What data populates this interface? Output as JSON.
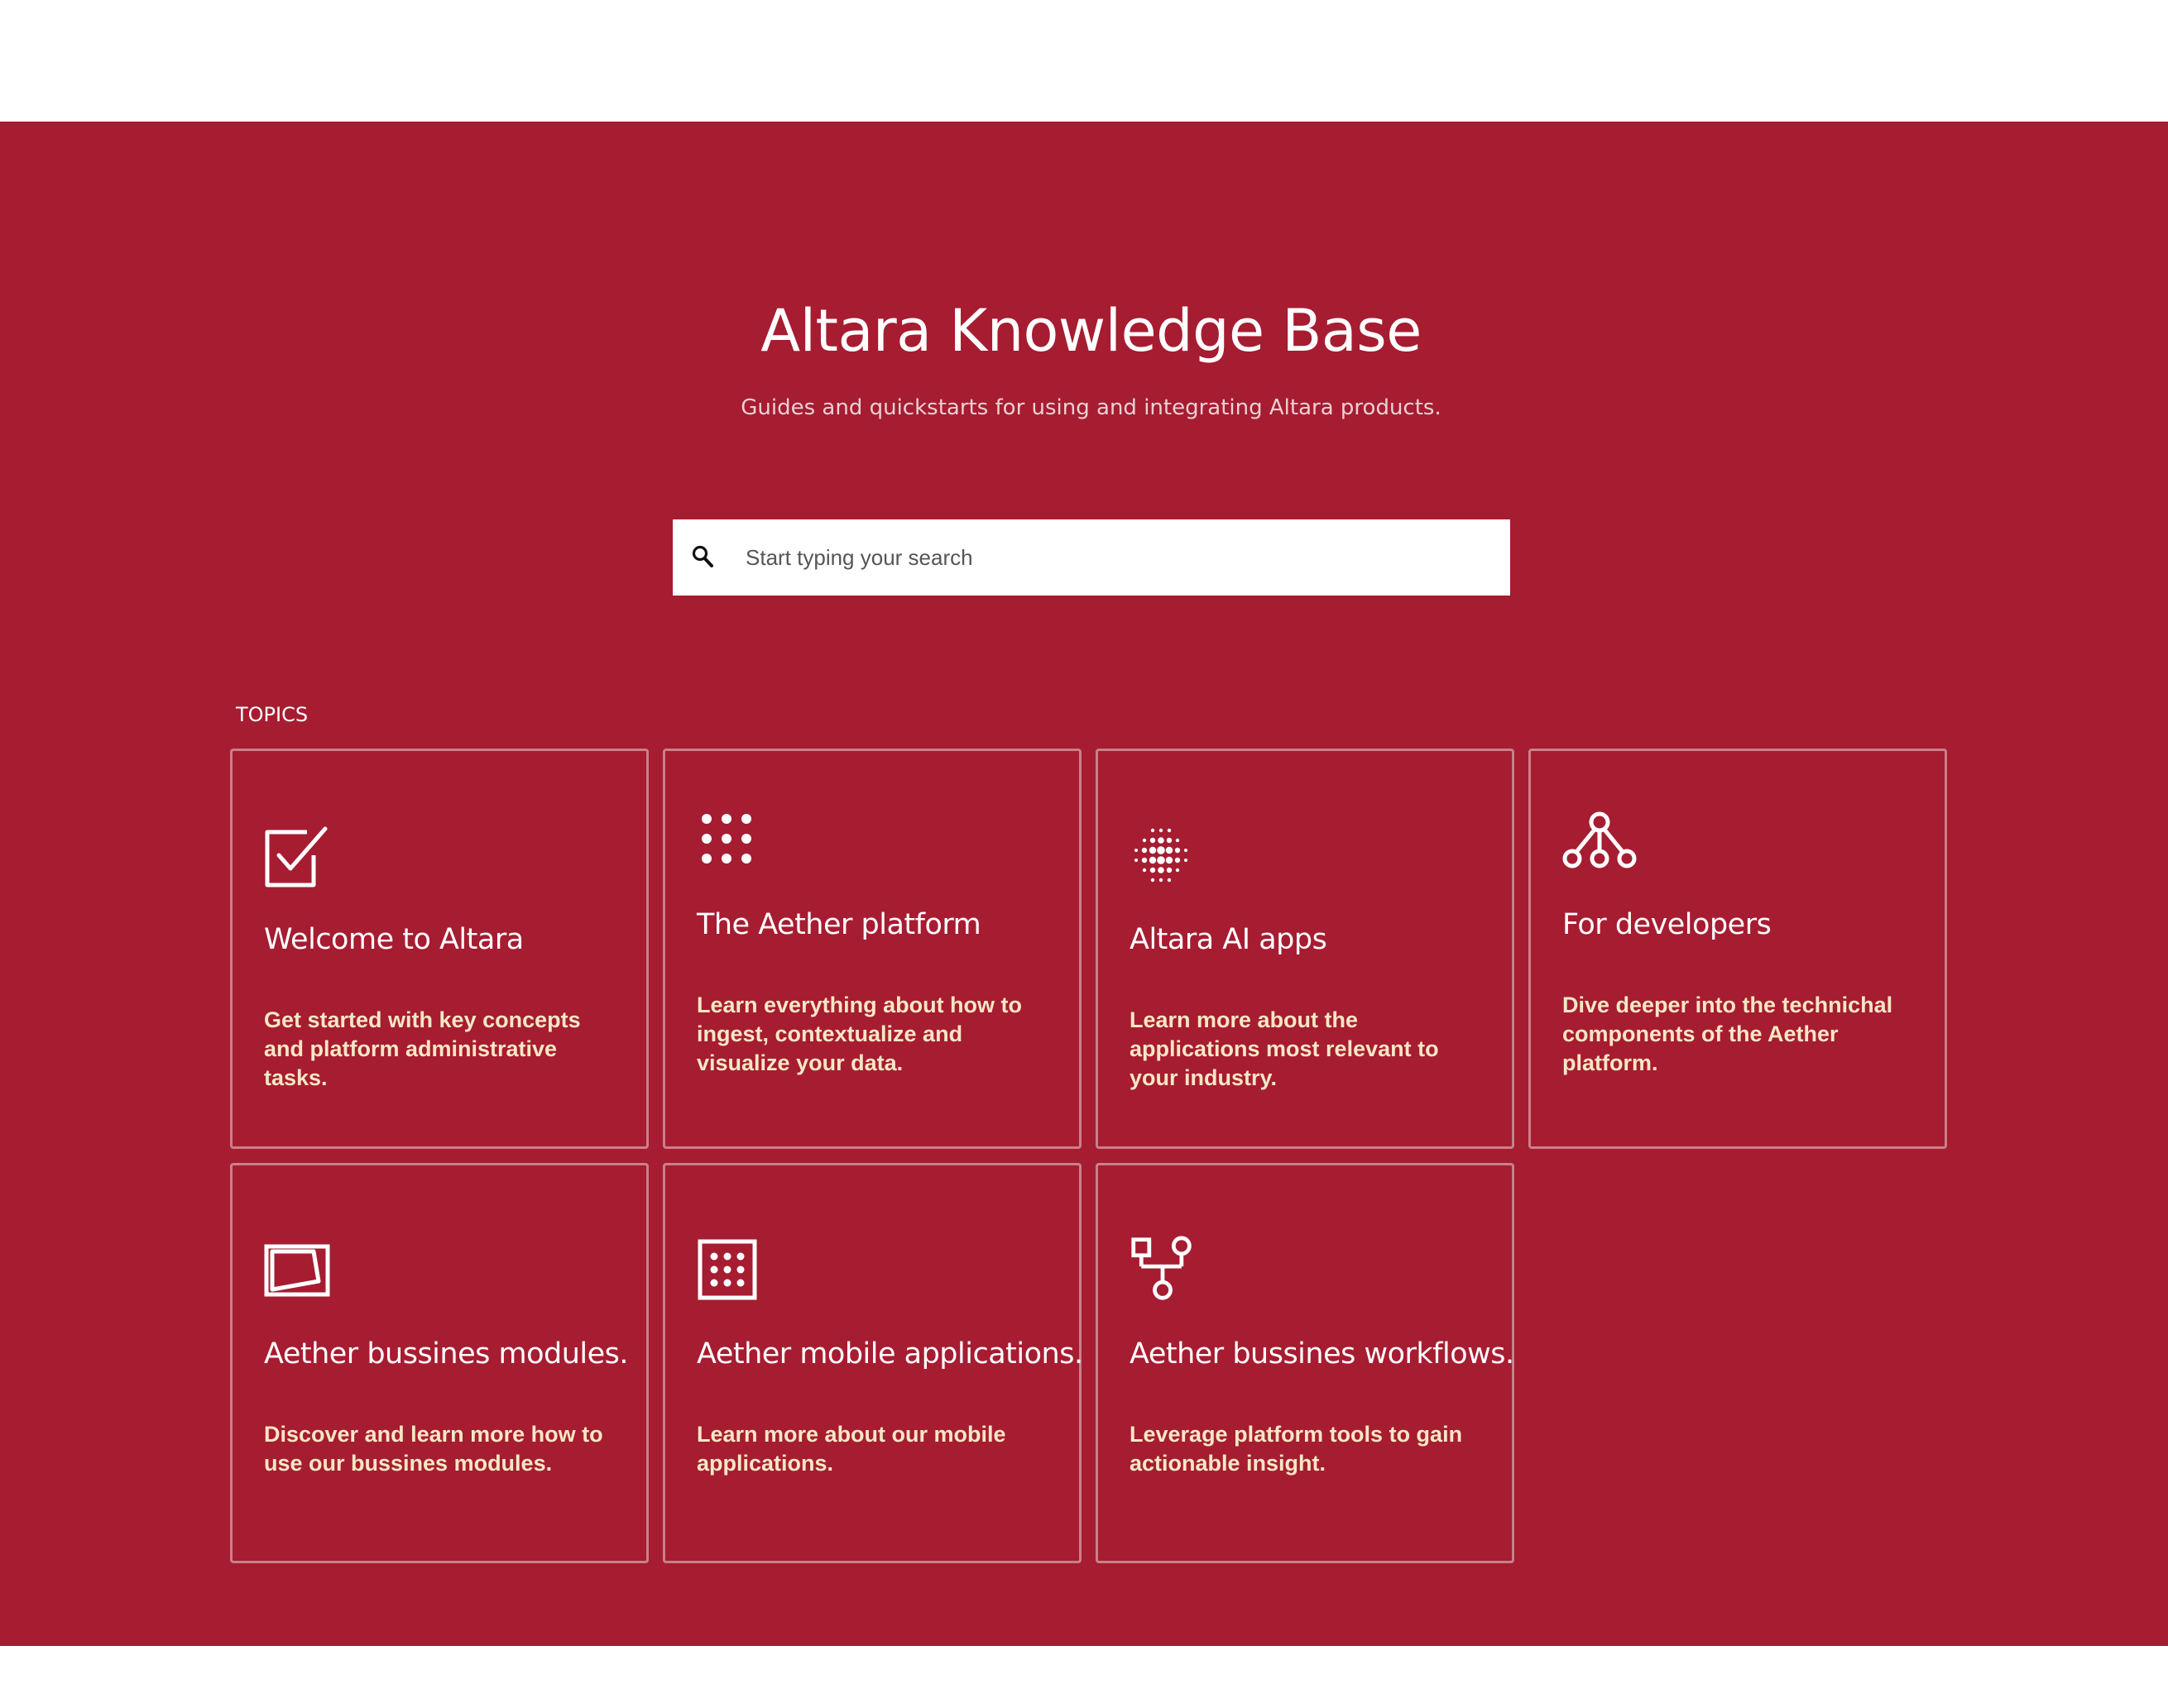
{
  "hero": {
    "title": "Altara Knowledge Base",
    "subtitle": "Guides and quickstarts for using and integrating Altara products.",
    "background_color": "#a61c31"
  },
  "search": {
    "placeholder": "Start typing your search",
    "value": "",
    "icon": "search-icon"
  },
  "topics": {
    "label": "TOPICS",
    "cards": [
      {
        "title": "Welcome to Altara",
        "description": "Get started with key concepts and platform administrative tasks.",
        "icon": "checkbox-icon"
      },
      {
        "title": "The Aether platform",
        "description": "Learn everything about how to ingest, contextualize and visualize your data.",
        "icon": "dots-grid-icon"
      },
      {
        "title": "Altara AI apps",
        "description": "Learn more about the applications most relevant to your industry.",
        "icon": "dot-sphere-icon"
      },
      {
        "title": "For developers",
        "description": "Dive deeper into the technichal components of the Aether platform.",
        "icon": "node-tree-icon"
      },
      {
        "title": "Aether bussines modules.",
        "description": "Discover and learn more how to use our bussines modules.",
        "icon": "tablet-icon"
      },
      {
        "title": "Aether mobile applications.",
        "description": "Learn more about our mobile applications.",
        "icon": "app-grid-icon"
      },
      {
        "title": "Aether bussines workflows.",
        "description": "Leverage platform tools to gain actionable insight.",
        "icon": "workflow-icon"
      }
    ]
  }
}
